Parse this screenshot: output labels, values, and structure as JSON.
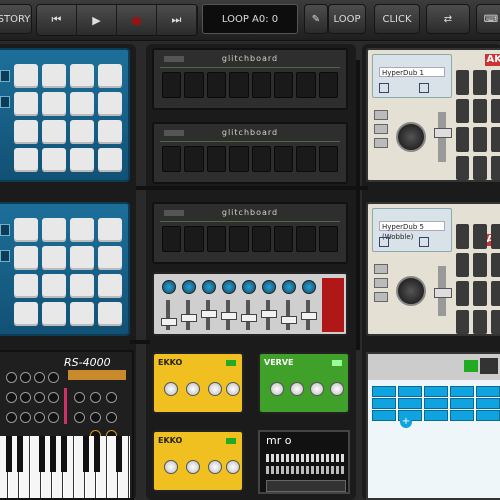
{
  "toolbar": {
    "history_label": "STORY",
    "transport": [
      "⏮",
      "▶",
      "●",
      "⏭"
    ],
    "loop_display": "LOOP A0: 0",
    "pencil_icon": "pencil-icon",
    "loop_label": "LOOP",
    "click_label": "CLICK",
    "swap_icon": "swap-icon",
    "keyboard_icon": "keyboard-icon"
  },
  "modules": {
    "glitchboard_label": "glitchboard",
    "hyperdub1_name": "HyperDub 1",
    "hyperdub5_name": "HyperDub 5 (Wobble)",
    "akai_label": "AK",
    "synth_label": "RS-4000",
    "pedal_yellow1": "EKKO",
    "pedal_green": "VERVE",
    "pedal_yellow2": "EKKO",
    "mro_label": "mr o"
  },
  "colors": {
    "accent_blue": "#1c6f9a",
    "pedal_yellow": "#f0c020",
    "pedal_green": "#3fa02a",
    "mixer_red": "#b01818"
  }
}
